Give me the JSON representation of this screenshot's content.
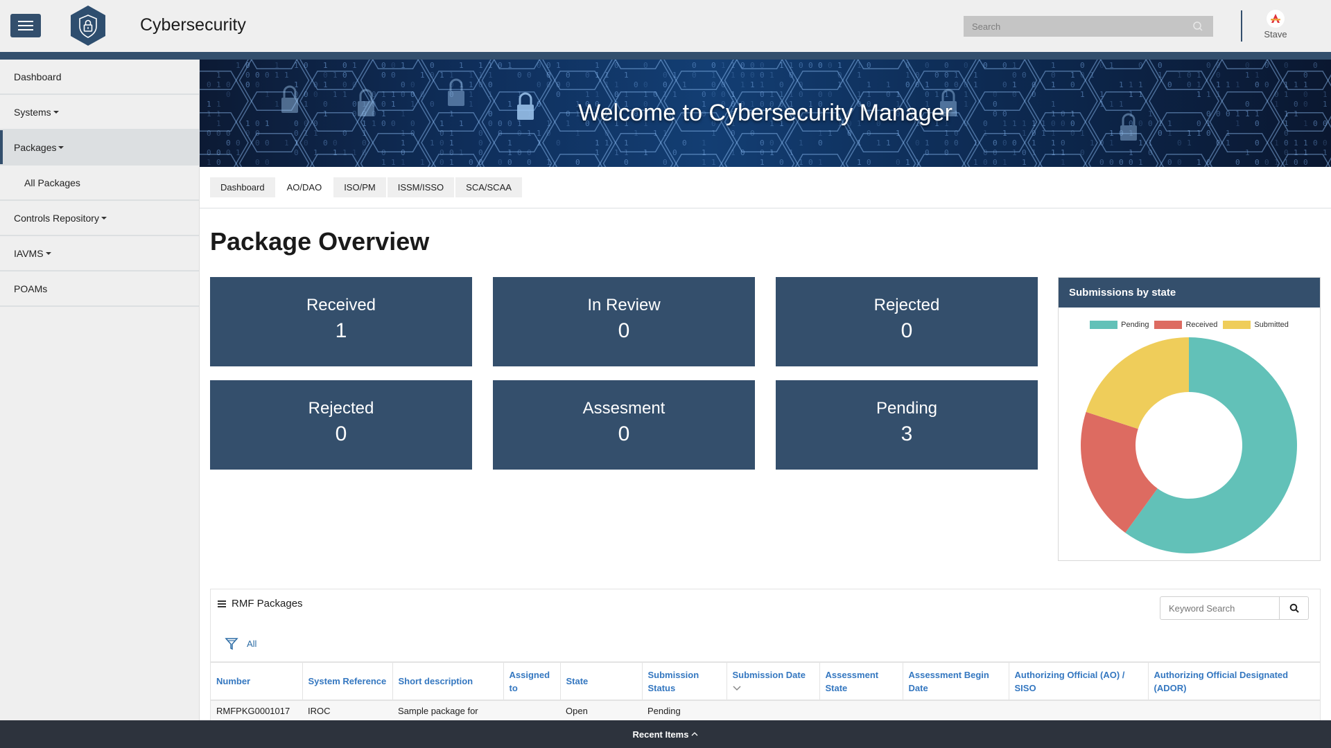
{
  "header": {
    "app_title": "Cybersecurity",
    "search_placeholder": "Search",
    "user_name": "Stave"
  },
  "sidebar": {
    "items": [
      {
        "label": "Dashboard",
        "dropdown": false
      },
      {
        "label": "Systems",
        "dropdown": true
      },
      {
        "label": "Packages",
        "dropdown": true,
        "active": true
      },
      {
        "label": "All Packages",
        "sub": true
      },
      {
        "label": "Controls Repository",
        "dropdown": true
      },
      {
        "label": "IAVMS",
        "dropdown": true
      },
      {
        "label": "POAMs",
        "dropdown": false
      }
    ]
  },
  "banner": {
    "title": "Welcome to Cybersecurity Manager"
  },
  "tabs": [
    {
      "label": "Dashboard"
    },
    {
      "label": "AO/DAO",
      "active": true
    },
    {
      "label": "ISO/PM"
    },
    {
      "label": "ISSM/ISSO"
    },
    {
      "label": "SCA/SCAA"
    }
  ],
  "page_title": "Package Overview",
  "cards": [
    {
      "label": "Received",
      "value": "1"
    },
    {
      "label": "In Review",
      "value": "0"
    },
    {
      "label": "Rejected",
      "value": "0"
    },
    {
      "label": "Rejected",
      "value": "0"
    },
    {
      "label": "Assesment",
      "value": "0"
    },
    {
      "label": "Pending",
      "value": "3"
    }
  ],
  "chart_data": {
    "type": "pie",
    "title": "Submissions by state",
    "categories": [
      "Pending",
      "Received",
      "Submitted"
    ],
    "values": [
      3,
      1,
      1
    ],
    "colors": [
      "#62c1b8",
      "#dd6b61",
      "#efcd5a"
    ],
    "donut": true,
    "legend": "top"
  },
  "table": {
    "title": "RMF Packages",
    "keyword_placeholder": "Keyword Search",
    "filter_label": "All",
    "columns": [
      "Number",
      "System Reference",
      "Short description",
      "Assigned to",
      "State",
      "Submission Status",
      "Submission Date",
      "Assessment State",
      "Assessment Begin Date",
      "Authorizing Official (AO) / SISO",
      "Authorizing Official Designated (ADOR)"
    ],
    "rows": [
      [
        "RMFPKG0001017",
        "IROC",
        "Sample package for",
        "",
        "Open",
        "Pending",
        "",
        "",
        "",
        "",
        ""
      ]
    ]
  },
  "footer": {
    "recent_items": "Recent Items"
  }
}
